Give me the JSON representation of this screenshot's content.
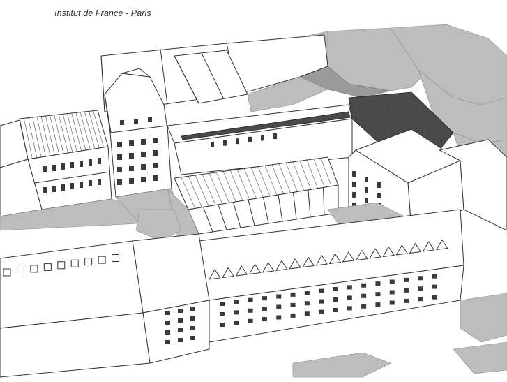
{
  "caption": "Institut de France - Paris",
  "palette": {
    "line": "#333333",
    "shadow": "#bdbdbd",
    "shadow_dark": "#9a9a9a",
    "glass_roof": "#4a4a4a",
    "background": "#ffffff"
  }
}
